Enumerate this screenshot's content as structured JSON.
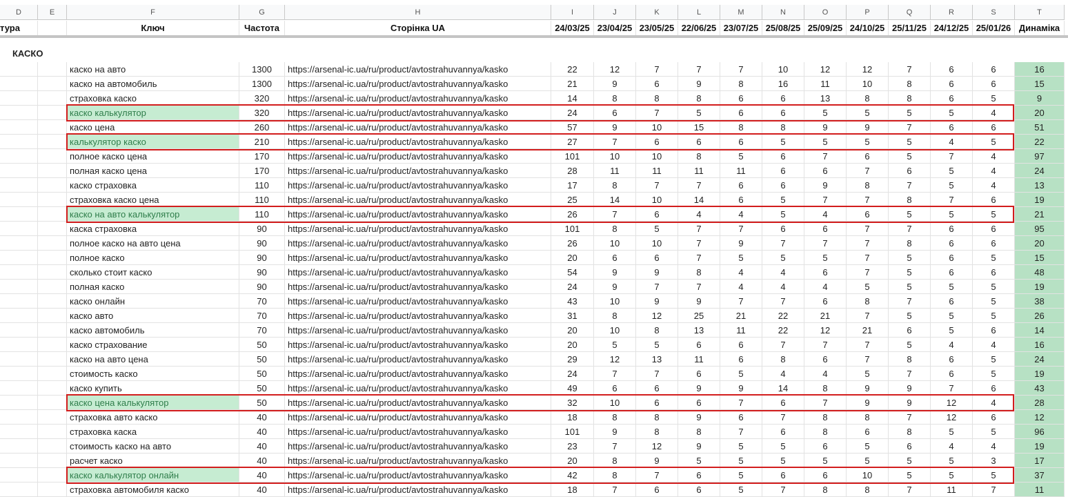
{
  "columns": {
    "letters": [
      "D",
      "E",
      "F",
      "G",
      "H",
      "I",
      "J",
      "K",
      "L",
      "M",
      "N",
      "O",
      "P",
      "Q",
      "R",
      "S",
      "T"
    ],
    "headers": [
      "тура",
      "",
      "Ключ",
      "Частота",
      "Сторінка UA",
      "24/03/25",
      "23/04/25",
      "23/05/25",
      "22/06/25",
      "23/07/25",
      "25/08/25",
      "25/09/25",
      "24/10/25",
      "25/11/25",
      "24/12/25",
      "25/01/26",
      "Динаміка"
    ]
  },
  "section_title": "КАСКО",
  "rows": [
    {
      "kw": "каско на авто",
      "freq": "1300",
      "url": "https://arsenal-ic.ua/ru/product/avtostrahuvannya/kasko",
      "pos": [
        "22",
        "12",
        "7",
        "7",
        "7",
        "10",
        "12",
        "12",
        "7",
        "6",
        "6"
      ],
      "dyn": "16",
      "hl": false
    },
    {
      "kw": "каско на автомобиль",
      "freq": "1300",
      "url": "https://arsenal-ic.ua/ru/product/avtostrahuvannya/kasko",
      "pos": [
        "21",
        "9",
        "6",
        "9",
        "8",
        "16",
        "11",
        "10",
        "8",
        "6",
        "6"
      ],
      "dyn": "15",
      "hl": false
    },
    {
      "kw": "страховка каско",
      "freq": "320",
      "url": "https://arsenal-ic.ua/ru/product/avtostrahuvannya/kasko",
      "pos": [
        "14",
        "8",
        "8",
        "8",
        "6",
        "6",
        "13",
        "8",
        "8",
        "6",
        "5"
      ],
      "dyn": "9",
      "hl": false
    },
    {
      "kw": "каско калькулятор",
      "freq": "320",
      "url": "https://arsenal-ic.ua/ru/product/avtostrahuvannya/kasko",
      "pos": [
        "24",
        "6",
        "7",
        "5",
        "6",
        "6",
        "5",
        "5",
        "5",
        "5",
        "4"
      ],
      "dyn": "20",
      "hl": true
    },
    {
      "kw": "каско цена",
      "freq": "260",
      "url": "https://arsenal-ic.ua/ru/product/avtostrahuvannya/kasko",
      "pos": [
        "57",
        "9",
        "10",
        "15",
        "8",
        "8",
        "9",
        "9",
        "7",
        "6",
        "6"
      ],
      "dyn": "51",
      "hl": false
    },
    {
      "kw": "калькулятор каско",
      "freq": "210",
      "url": "https://arsenal-ic.ua/ru/product/avtostrahuvannya/kasko",
      "pos": [
        "27",
        "7",
        "6",
        "6",
        "6",
        "5",
        "5",
        "5",
        "5",
        "4",
        "5"
      ],
      "dyn": "22",
      "hl": true
    },
    {
      "kw": "полное каско цена",
      "freq": "170",
      "url": "https://arsenal-ic.ua/ru/product/avtostrahuvannya/kasko",
      "pos": [
        "101",
        "10",
        "10",
        "8",
        "5",
        "6",
        "7",
        "6",
        "5",
        "7",
        "4"
      ],
      "dyn": "97",
      "hl": false
    },
    {
      "kw": "полная каско цена",
      "freq": "170",
      "url": "https://arsenal-ic.ua/ru/product/avtostrahuvannya/kasko",
      "pos": [
        "28",
        "11",
        "11",
        "11",
        "11",
        "6",
        "6",
        "7",
        "6",
        "5",
        "4"
      ],
      "dyn": "24",
      "hl": false
    },
    {
      "kw": "каско страховка",
      "freq": "110",
      "url": "https://arsenal-ic.ua/ru/product/avtostrahuvannya/kasko",
      "pos": [
        "17",
        "8",
        "7",
        "7",
        "6",
        "6",
        "9",
        "8",
        "7",
        "5",
        "4"
      ],
      "dyn": "13",
      "hl": false
    },
    {
      "kw": "страховка каско цена",
      "freq": "110",
      "url": "https://arsenal-ic.ua/ru/product/avtostrahuvannya/kasko",
      "pos": [
        "25",
        "14",
        "10",
        "14",
        "6",
        "5",
        "7",
        "7",
        "8",
        "7",
        "6"
      ],
      "dyn": "19",
      "hl": false
    },
    {
      "kw": "каско на авто калькулятор",
      "freq": "110",
      "url": "https://arsenal-ic.ua/ru/product/avtostrahuvannya/kasko",
      "pos": [
        "26",
        "7",
        "6",
        "4",
        "4",
        "5",
        "4",
        "6",
        "5",
        "5",
        "5"
      ],
      "dyn": "21",
      "hl": true
    },
    {
      "kw": "каска страховка",
      "freq": "90",
      "url": "https://arsenal-ic.ua/ru/product/avtostrahuvannya/kasko",
      "pos": [
        "101",
        "8",
        "5",
        "7",
        "7",
        "6",
        "6",
        "7",
        "7",
        "6",
        "6"
      ],
      "dyn": "95",
      "hl": false
    },
    {
      "kw": "полное каско на авто цена",
      "freq": "90",
      "url": "https://arsenal-ic.ua/ru/product/avtostrahuvannya/kasko",
      "pos": [
        "26",
        "10",
        "10",
        "7",
        "9",
        "7",
        "7",
        "7",
        "8",
        "6",
        "6"
      ],
      "dyn": "20",
      "hl": false
    },
    {
      "kw": "полное каско",
      "freq": "90",
      "url": "https://arsenal-ic.ua/ru/product/avtostrahuvannya/kasko",
      "pos": [
        "20",
        "6",
        "6",
        "7",
        "5",
        "5",
        "5",
        "7",
        "5",
        "6",
        "5"
      ],
      "dyn": "15",
      "hl": false
    },
    {
      "kw": "сколько стоит каско",
      "freq": "90",
      "url": "https://arsenal-ic.ua/ru/product/avtostrahuvannya/kasko",
      "pos": [
        "54",
        "9",
        "9",
        "8",
        "4",
        "4",
        "6",
        "7",
        "5",
        "6",
        "6"
      ],
      "dyn": "48",
      "hl": false
    },
    {
      "kw": "полная каско",
      "freq": "90",
      "url": "https://arsenal-ic.ua/ru/product/avtostrahuvannya/kasko",
      "pos": [
        "24",
        "9",
        "7",
        "7",
        "4",
        "4",
        "4",
        "5",
        "5",
        "5",
        "5"
      ],
      "dyn": "19",
      "hl": false
    },
    {
      "kw": "каско онлайн",
      "freq": "70",
      "url": "https://arsenal-ic.ua/ru/product/avtostrahuvannya/kasko",
      "pos": [
        "43",
        "10",
        "9",
        "9",
        "7",
        "7",
        "6",
        "8",
        "7",
        "6",
        "5"
      ],
      "dyn": "38",
      "hl": false
    },
    {
      "kw": "каско авто",
      "freq": "70",
      "url": "https://arsenal-ic.ua/ru/product/avtostrahuvannya/kasko",
      "pos": [
        "31",
        "8",
        "12",
        "25",
        "21",
        "22",
        "21",
        "7",
        "5",
        "5",
        "5"
      ],
      "dyn": "26",
      "hl": false
    },
    {
      "kw": "каско автомобиль",
      "freq": "70",
      "url": "https://arsenal-ic.ua/ru/product/avtostrahuvannya/kasko",
      "pos": [
        "20",
        "10",
        "8",
        "13",
        "11",
        "22",
        "12",
        "21",
        "6",
        "5",
        "6"
      ],
      "dyn": "14",
      "hl": false
    },
    {
      "kw": "каско страхование",
      "freq": "50",
      "url": "https://arsenal-ic.ua/ru/product/avtostrahuvannya/kasko",
      "pos": [
        "20",
        "5",
        "5",
        "6",
        "6",
        "7",
        "7",
        "7",
        "5",
        "4",
        "4"
      ],
      "dyn": "16",
      "hl": false
    },
    {
      "kw": "каско на авто цена",
      "freq": "50",
      "url": "https://arsenal-ic.ua/ru/product/avtostrahuvannya/kasko",
      "pos": [
        "29",
        "12",
        "13",
        "11",
        "6",
        "8",
        "6",
        "7",
        "8",
        "6",
        "5"
      ],
      "dyn": "24",
      "hl": false
    },
    {
      "kw": "стоимость каско",
      "freq": "50",
      "url": "https://arsenal-ic.ua/ru/product/avtostrahuvannya/kasko",
      "pos": [
        "24",
        "7",
        "7",
        "6",
        "5",
        "4",
        "4",
        "5",
        "7",
        "6",
        "5"
      ],
      "dyn": "19",
      "hl": false
    },
    {
      "kw": "каско купить",
      "freq": "50",
      "url": "https://arsenal-ic.ua/ru/product/avtostrahuvannya/kasko",
      "pos": [
        "49",
        "6",
        "6",
        "9",
        "9",
        "14",
        "8",
        "9",
        "9",
        "7",
        "6"
      ],
      "dyn": "43",
      "hl": false
    },
    {
      "kw": "каско цена калькулятор",
      "freq": "50",
      "url": "https://arsenal-ic.ua/ru/product/avtostrahuvannya/kasko",
      "pos": [
        "32",
        "10",
        "6",
        "6",
        "7",
        "6",
        "7",
        "9",
        "9",
        "12",
        "4"
      ],
      "dyn": "28",
      "hl": true
    },
    {
      "kw": "страховка авто каско",
      "freq": "40",
      "url": "https://arsenal-ic.ua/ru/product/avtostrahuvannya/kasko",
      "pos": [
        "18",
        "8",
        "8",
        "9",
        "6",
        "7",
        "8",
        "8",
        "7",
        "12",
        "6"
      ],
      "dyn": "12",
      "hl": false
    },
    {
      "kw": "страховка каска",
      "freq": "40",
      "url": "https://arsenal-ic.ua/ru/product/avtostrahuvannya/kasko",
      "pos": [
        "101",
        "9",
        "8",
        "8",
        "7",
        "6",
        "8",
        "6",
        "8",
        "5",
        "5"
      ],
      "dyn": "96",
      "hl": false
    },
    {
      "kw": "стоимость каско на авто",
      "freq": "40",
      "url": "https://arsenal-ic.ua/ru/product/avtostrahuvannya/kasko",
      "pos": [
        "23",
        "7",
        "12",
        "9",
        "5",
        "5",
        "6",
        "5",
        "6",
        "4",
        "4"
      ],
      "dyn": "19",
      "hl": false
    },
    {
      "kw": "расчет каско",
      "freq": "40",
      "url": "https://arsenal-ic.ua/ru/product/avtostrahuvannya/kasko",
      "pos": [
        "20",
        "8",
        "9",
        "5",
        "5",
        "5",
        "5",
        "5",
        "5",
        "5",
        "3"
      ],
      "dyn": "17",
      "hl": false
    },
    {
      "kw": "каско калькулятор онлайн",
      "freq": "40",
      "url": "https://arsenal-ic.ua/ru/product/avtostrahuvannya/kasko",
      "pos": [
        "42",
        "8",
        "7",
        "6",
        "5",
        "6",
        "6",
        "10",
        "5",
        "5",
        "5"
      ],
      "dyn": "37",
      "hl": true
    },
    {
      "kw": "страховка автомобиля каско",
      "freq": "40",
      "url": "https://arsenal-ic.ua/ru/product/avtostrahuvannya/kasko",
      "pos": [
        "18",
        "7",
        "6",
        "6",
        "5",
        "7",
        "8",
        "8",
        "7",
        "11",
        "7"
      ],
      "dyn": "11",
      "hl": false
    }
  ],
  "colors": {
    "highlight_border": "#d21c1c",
    "keyword_fill": "#c6ecd2",
    "dynamics_fill": "#b7e1c4"
  }
}
